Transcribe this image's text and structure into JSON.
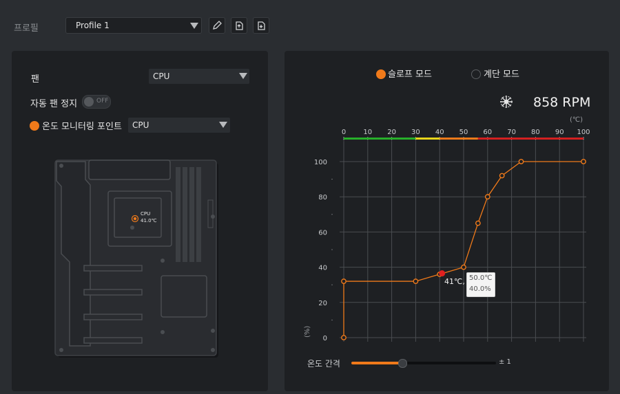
{
  "top": {
    "profile_label": "프로필",
    "profile_value": "Profile 1"
  },
  "left": {
    "fan_label": "팬",
    "fan_value": "CPU",
    "auto_stop_label": "자동 팬 정지",
    "auto_stop_toggle": "OFF",
    "monitor_label": "온도 모니터링 포인트",
    "monitor_value": "CPU",
    "board_marker_name": "CPU",
    "board_marker_temp": "41.0℃"
  },
  "right": {
    "mode_slope": "슬로프 모드",
    "mode_step": "계단 모드",
    "rpm": "858 RPM",
    "unit_c": "(℃)",
    "unit_pct": "(%)",
    "interval_label": "온도 간격",
    "interval_value": "± 1",
    "interval_level": 0.35,
    "tooltip_temp": "50.0℃",
    "tooltip_pct": "40.0%",
    "current_label": "41℃,",
    "accent": "#f07a1a"
  },
  "chart_data": {
    "type": "line",
    "xlim": [
      0,
      100
    ],
    "ylim": [
      0,
      100
    ],
    "x_ticks": [
      "0",
      "10",
      "20",
      "30",
      "40",
      "50",
      "60",
      "70",
      "80",
      "90",
      "100"
    ],
    "y_ticks": [
      "0",
      "20",
      "40",
      "60",
      "80",
      "100"
    ],
    "series": [
      {
        "x": [
          0,
          0,
          30,
          40,
          50,
          56,
          60,
          66,
          74,
          100
        ],
        "y": [
          0,
          32,
          32,
          36,
          40,
          65,
          80,
          92,
          100,
          100
        ]
      }
    ],
    "current_point": {
      "x": 41,
      "y": 36.5
    },
    "temp_bands": [
      {
        "from": 0,
        "to": 30,
        "color": "#27b02a"
      },
      {
        "from": 30,
        "to": 40,
        "color": "#e8d51a"
      },
      {
        "from": 40,
        "to": 56,
        "color": "#f07a1a"
      },
      {
        "from": 56,
        "to": 100,
        "color": "#d42020"
      }
    ]
  }
}
